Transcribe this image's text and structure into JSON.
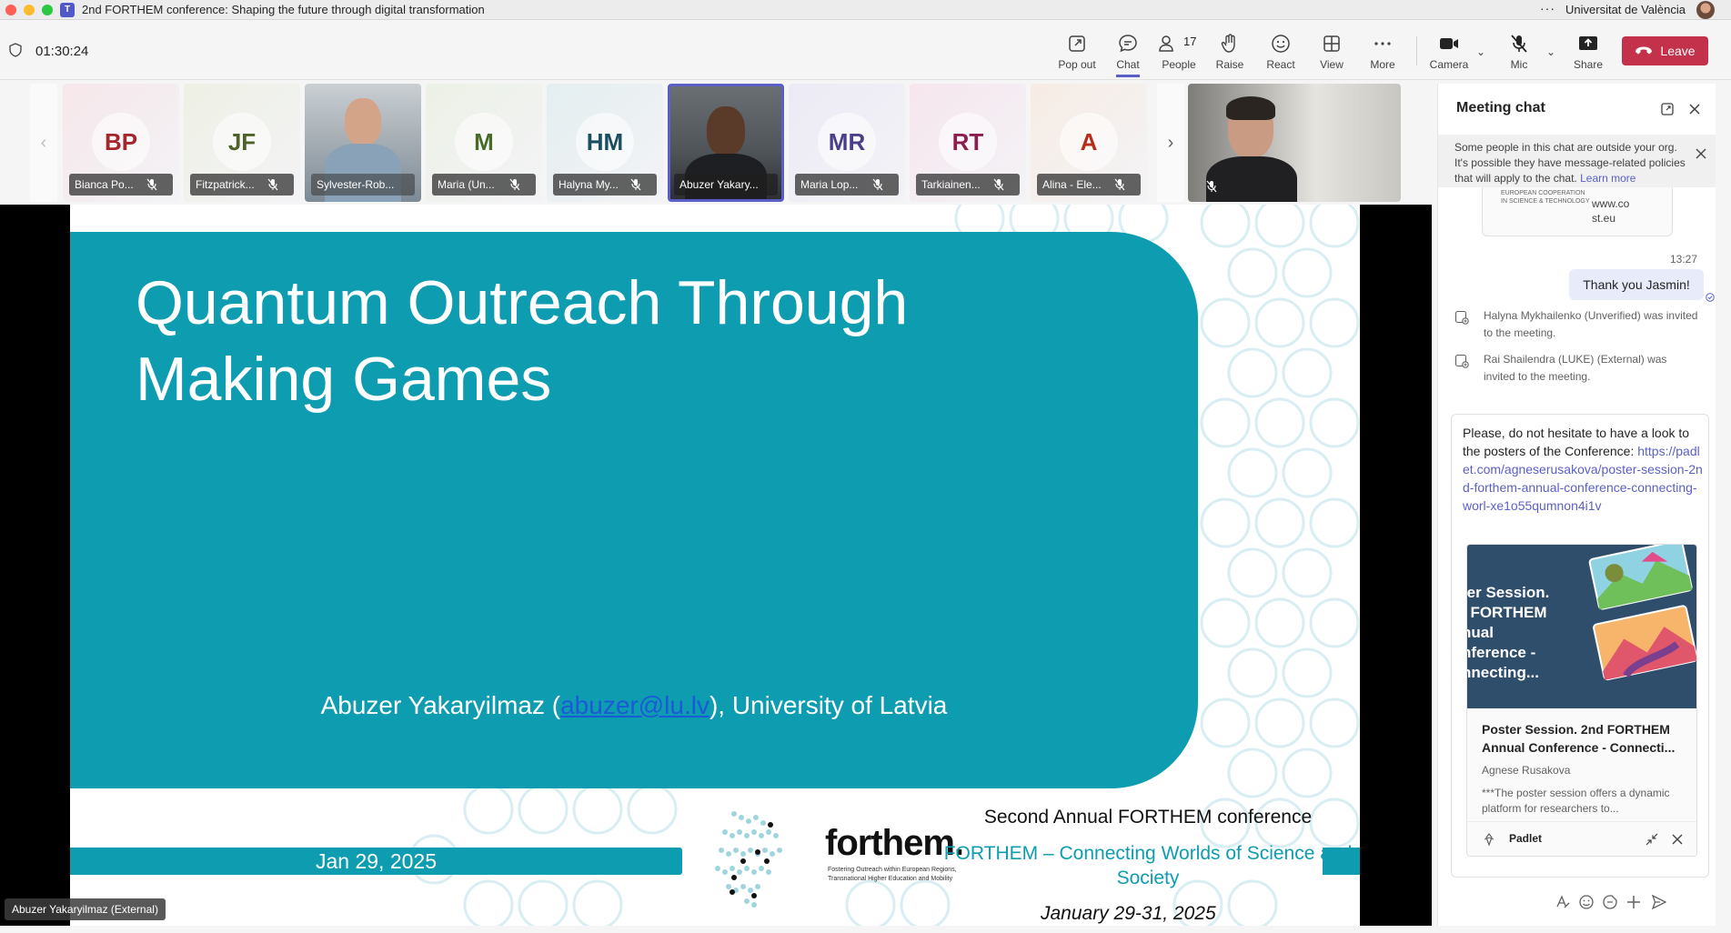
{
  "window": {
    "title": "2nd FORTHEM conference: Shaping the future through digital transformation",
    "org": "Universitat de València",
    "more": "···"
  },
  "toolbar": {
    "timer": "01:30:24",
    "popout": "Pop out",
    "chat": "Chat",
    "people": "People",
    "people_count": "17",
    "raise": "Raise",
    "react": "React",
    "view": "View",
    "more": "More",
    "camera": "Camera",
    "mic": "Mic",
    "share": "Share",
    "leave": "Leave"
  },
  "participants": [
    {
      "initials": "BP",
      "name": "Bianca Po...",
      "color": "#a4262c",
      "bg": "#f6e7ea"
    },
    {
      "initials": "JF",
      "name": "Fitzpatrick...",
      "color": "#4f6228",
      "bg": "#eef0e4"
    },
    {
      "initials": "",
      "name": "Sylvester-Rob...",
      "color": "",
      "bg": ""
    },
    {
      "initials": "M",
      "name": "Maria (Un...",
      "color": "#486b2a",
      "bg": "#ecf1e6"
    },
    {
      "initials": "HM",
      "name": "Halyna My...",
      "color": "#1b4e5f",
      "bg": "#e4eef0"
    },
    {
      "initials": "",
      "name": "Abuzer Yakary...",
      "color": "",
      "bg": ""
    },
    {
      "initials": "MR",
      "name": "Maria Lop...",
      "color": "#4b3f8a",
      "bg": "#eceaf5"
    },
    {
      "initials": "RT",
      "name": "Tarkiainen...",
      "color": "#8b1e4e",
      "bg": "#f6e6ee"
    },
    {
      "initials": "A",
      "name": "Alina - Ele...",
      "color": "#b52d19",
      "bg": "#f7ece4"
    }
  ],
  "slide": {
    "title_line1": "Quantum Outreach Through",
    "title_line2": "Making Games",
    "author_pre": "Abuzer Yakaryilmaz (",
    "author_email": "abuzer@lu.lv",
    "author_post": "), University of Latvia",
    "date": "Jan 29, 2025",
    "brand": "forthem.",
    "brand_sub": "Fostering Outreach within European Regions, Transnational Higher Education and Mobility",
    "conf_title": "Second Annual FORTHEM conference",
    "conf_sub": "FORTHEM – Connecting Worlds of Science and Society",
    "conf_dates": "January 29-31, 2025"
  },
  "presenter_label": "Abuzer Yakaryilmaz (External)",
  "chat": {
    "title": "Meeting chat",
    "notice": "Some people in this chat are outside your org. It's possible they have message-related policies that will apply to the chat.",
    "notice_link": "Learn more",
    "prev_card_logo": "EUROPEAN COOPERATION IN SCIENCE & TECHNOLOGY",
    "prev_card_link": "www.co st.eu",
    "time": "13:27",
    "my_message": "Thank you Jasmin!",
    "system1": "Halyna Mykhailenko (Unverified) was invited to the meeting.",
    "system2": "Rai Shailendra (LUKE) (External) was invited to the meeting.",
    "received_text": "Please, do not hesitate to have a look to the posters of the Conference:",
    "received_link": "https://padlet.com/agneserusakova/poster-session-2nd-forthem-annual-conference-connecting-worl-xe1o55qumnon4i1v",
    "card_thumb_text": "ter Session.\nI FORTHEM\nnual\nnference -\nnnecting...",
    "card_title": "Poster Session. 2nd FORTHEM Annual Conference - Connecti...",
    "card_author": "Agnese Rusakova",
    "card_desc": "***The poster session offers a dynamic platform for researchers to...",
    "card_source": "Padlet"
  }
}
